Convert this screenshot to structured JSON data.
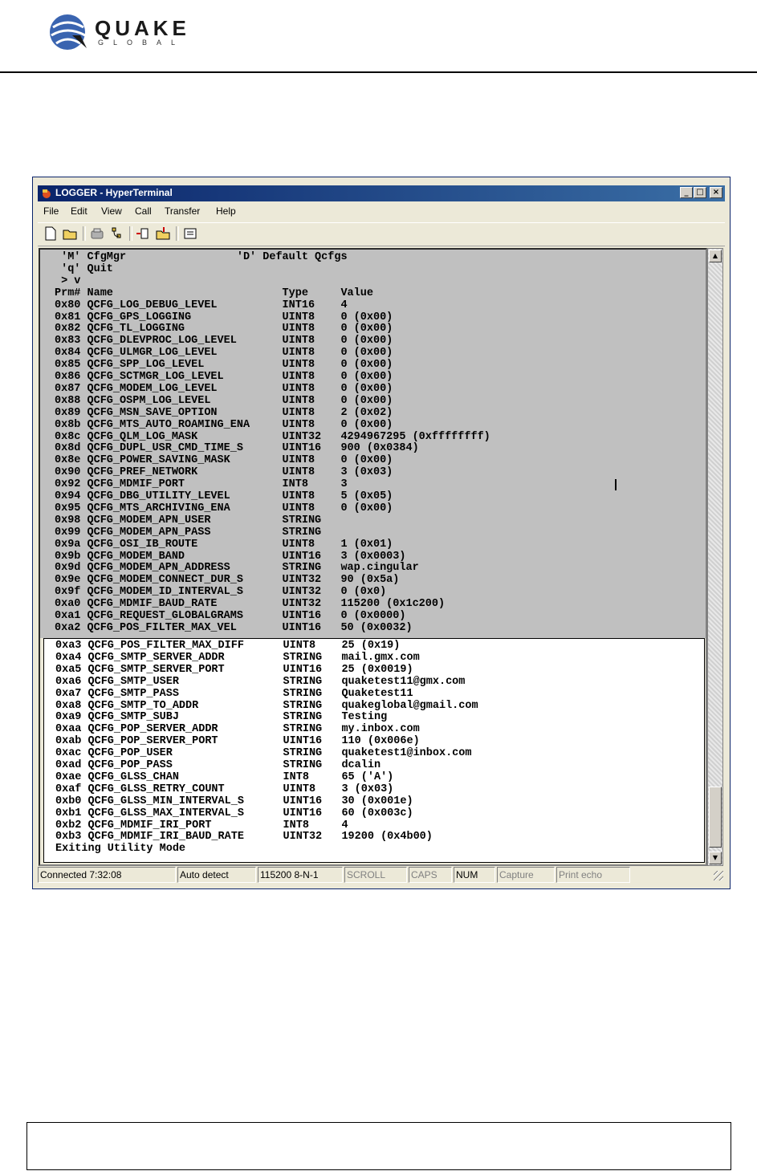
{
  "page": {
    "logo_word": "QUAKE",
    "logo_sub": "GLOBAL"
  },
  "window": {
    "title": "LOGGER - HyperTerminal",
    "controls": [
      "_",
      "□",
      "×"
    ],
    "menu": [
      "File",
      "Edit",
      "View",
      "Call",
      "Transfer",
      "Help"
    ],
    "toolbar_icons": [
      "new-icon",
      "open-icon",
      "disconnect-icon",
      "dial-icon",
      "send-icon",
      "receive-icon",
      "properties-icon"
    ]
  },
  "terminal": {
    "top_lines": [
      " 'M' CfgMgr                 'D' Default Qcfgs",
      " 'q' Quit",
      " > v",
      "Prm# Name                          Type     Value",
      "0x80 QCFG_LOG_DEBUG_LEVEL          INT16    4",
      "0x81 QCFG_GPS_LOGGING              UINT8    0 (0x00)",
      "0x82 QCFG_TL_LOGGING               UINT8    0 (0x00)",
      "0x83 QCFG_DLEVPROC_LOG_LEVEL       UINT8    0 (0x00)",
      "0x84 QCFG_ULMGR_LOG_LEVEL          UINT8    0 (0x00)",
      "0x85 QCFG_SPP_LOG_LEVEL            UINT8    0 (0x00)",
      "0x86 QCFG_SCTMGR_LOG_LEVEL         UINT8    0 (0x00)",
      "0x87 QCFG_MODEM_LOG_LEVEL          UINT8    0 (0x00)",
      "0x88 QCFG_OSPM_LOG_LEVEL           UINT8    0 (0x00)",
      "0x89 QCFG_MSN_SAVE_OPTION          UINT8    2 (0x02)",
      "0x8b QCFG_MTS_AUTO_ROAMING_ENA     UINT8    0 (0x00)",
      "0x8c QCFG_QLM_LOG_MASK             UINT32   4294967295 (0xffffffff)",
      "0x8d QCFG_DUPL_USR_CMD_TIME_S      UINT16   900 (0x0384)",
      "0x8e QCFG_POWER_SAVING_MASK        UINT8    0 (0x00)",
      "0x90 QCFG_PREF_NETWORK             UINT8    3 (0x03)",
      "0x92 QCFG_MDMIF_PORT               INT8     3",
      "0x94 QCFG_DBG_UTILITY_LEVEL        UINT8    5 (0x05)",
      "0x95 QCFG_MTS_ARCHIVING_ENA        UINT8    0 (0x00)",
      "0x98 QCFG_MODEM_APN_USER           STRING",
      "0x99 QCFG_MODEM_APN_PASS           STRING",
      "0x9a QCFG_OSI_IB_ROUTE             UINT8    1 (0x01)",
      "0x9b QCFG_MODEM_BAND               UINT16   3 (0x0003)",
      "0x9d QCFG_MODEM_APN_ADDRESS        STRING   wap.cingular",
      "0x9e QCFG_MODEM_CONNECT_DUR_S      UINT32   90 (0x5a)",
      "0x9f QCFG_MODEM_ID_INTERVAL_S      UINT32   0 (0x0)",
      "0xa0 QCFG_MDMIF_BAUD_RATE          UINT32   115200 (0x1c200)",
      "0xa1 QCFG_REQUEST_GLOBALGRAMS      UINT16   0 (0x0000)",
      "0xa2 QCFG_POS_FILTER_MAX_VEL       UINT16   50 (0x0032)"
    ],
    "bottom_lines": [
      "0xa3 QCFG_POS_FILTER_MAX_DIFF      UINT8    25 (0x19)",
      "0xa4 QCFG_SMTP_SERVER_ADDR         STRING   mail.gmx.com",
      "0xa5 QCFG_SMTP_SERVER_PORT         UINT16   25 (0x0019)",
      "0xa6 QCFG_SMTP_USER                STRING   quaketest11@gmx.com",
      "0xa7 QCFG_SMTP_PASS                STRING   Quaketest11",
      "0xa8 QCFG_SMTP_TO_ADDR             STRING   quakeglobal@gmail.com",
      "0xa9 QCFG_SMTP_SUBJ                STRING   Testing",
      "0xaa QCFG_POP_SERVER_ADDR          STRING   my.inbox.com",
      "0xab QCFG_POP_SERVER_PORT          UINT16   110 (0x006e)",
      "0xac QCFG_POP_USER                 STRING   quaketest1@inbox.com",
      "0xad QCFG_POP_PASS                 STRING   dcalin",
      "0xae QCFG_GLSS_CHAN                INT8     65 ('A')",
      "0xaf QCFG_GLSS_RETRY_COUNT         UINT8    3 (0x03)",
      "0xb0 QCFG_GLSS_MIN_INTERVAL_S      UINT16   30 (0x001e)",
      "0xb1 QCFG_GLSS_MAX_INTERVAL_S      UINT16   60 (0x003c)",
      "0xb2 QCFG_MDMIF_IRI_PORT           INT8     4",
      "0xb3 QCFG_MDMIF_IRI_BAUD_RATE      UINT32   19200 (0x4b00)",
      "Exiting Utility Mode"
    ]
  },
  "statusbar": {
    "cells": [
      "Connected 7:32:08",
      "Auto detect",
      "115200 8-N-1",
      "SCROLL",
      "CAPS",
      "NUM",
      "Capture",
      "Print echo"
    ]
  }
}
